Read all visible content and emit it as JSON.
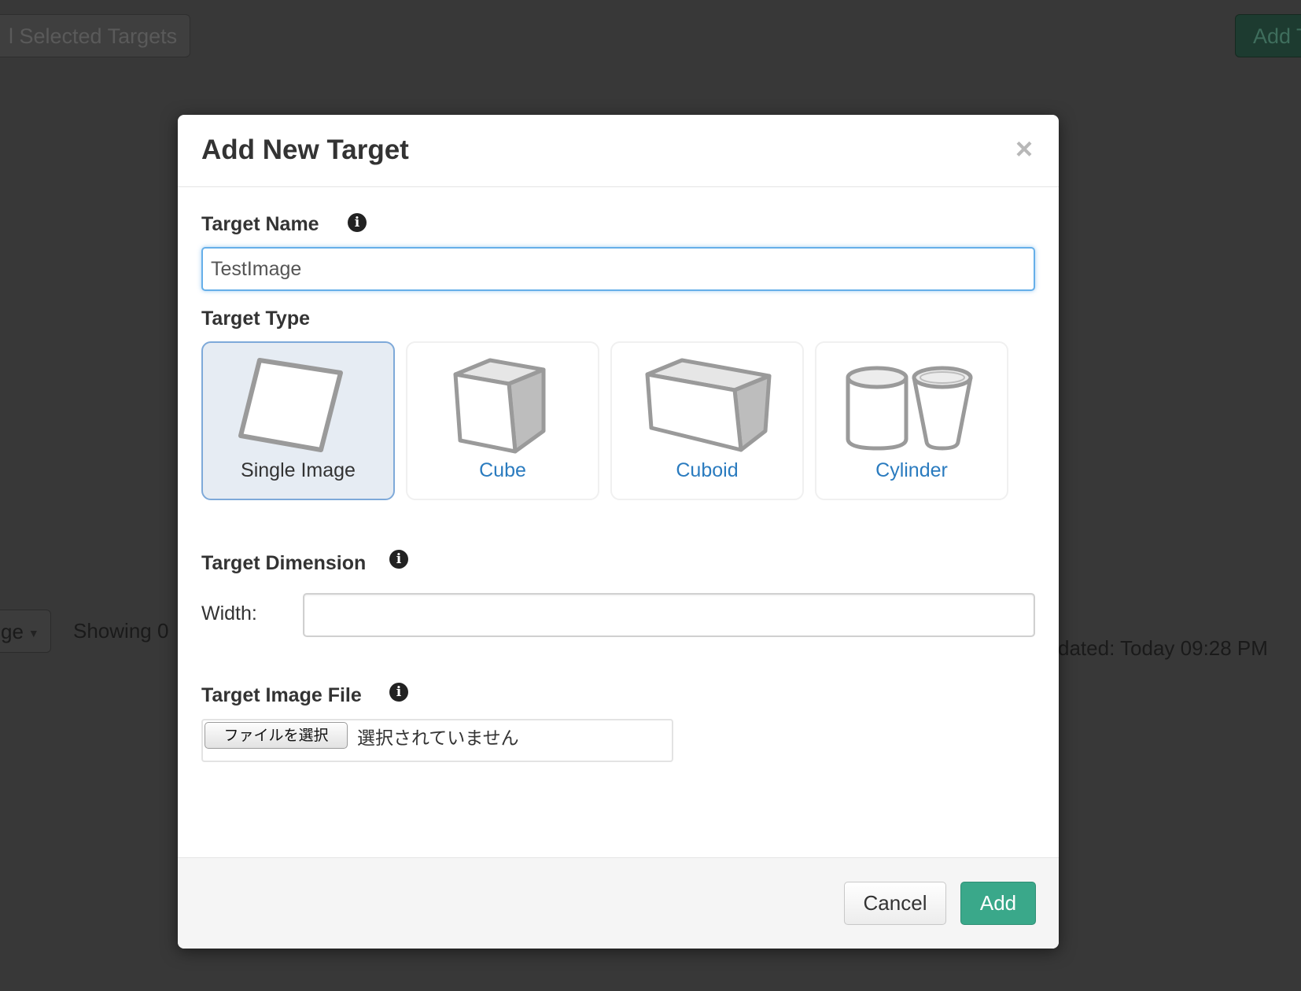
{
  "background": {
    "delete_selected_label": "l Selected Targets",
    "add_target_label": "Add T",
    "filter_label": "ge",
    "showing_text": "Showing 0",
    "updated_text": "dated: Today 09:28 PM"
  },
  "modal": {
    "title": "Add New Target",
    "close_glyph": "×",
    "target_name": {
      "label": "Target Name",
      "value": "TestImage"
    },
    "target_type": {
      "label": "Target Type",
      "options": [
        {
          "label": "Single Image",
          "selected": true
        },
        {
          "label": "Cube",
          "selected": false
        },
        {
          "label": "Cuboid",
          "selected": false
        },
        {
          "label": "Cylinder",
          "selected": false
        }
      ]
    },
    "target_dimension": {
      "label": "Target Dimension",
      "width_label": "Width:",
      "width_value": ""
    },
    "target_image_file": {
      "label": "Target Image File",
      "button_label": "ファイルを選択",
      "status_text": "選択されていません"
    },
    "footer": {
      "cancel_label": "Cancel",
      "add_label": "Add"
    }
  },
  "colors": {
    "overlay": "#383838",
    "link_blue": "#2a7bbf",
    "add_green": "#3aa88a",
    "focus_blue": "#66afe9",
    "selected_card_bg": "#e6ecf3"
  }
}
